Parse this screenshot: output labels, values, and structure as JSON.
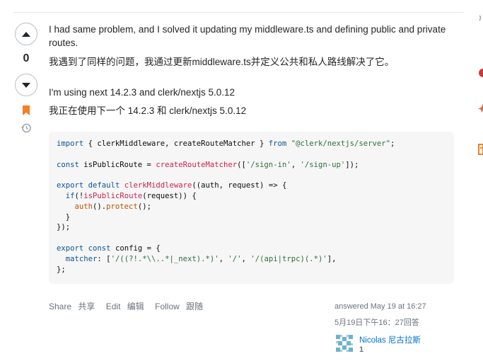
{
  "vote": {
    "count": "0"
  },
  "post": {
    "paragraph_en_1": "I had same problem, and I solved it updating my middleware.ts and defining public and private routes.",
    "paragraph_zh_1": "我遇到了同样的问题，我通过更新middleware.ts并定义公共和私人路线解决了它。",
    "paragraph_en_2": "I'm using next 14.2.3 and clerk/nextjs 5.0.12",
    "paragraph_zh_2": "我正在使用下一个 14.2.3 和 clerk/nextjs 5.0.12"
  },
  "code": {
    "l1a": "import",
    "l1b": " { clerkMiddleware, createRouteMatcher } ",
    "l1c": "from",
    "l1d": " ",
    "l1e": "\"@clerk/nextjs/server\"",
    "l1f": ";",
    "l3a": "const",
    "l3b": " isPublicRoute = ",
    "l3c": "createRouteMatcher",
    "l3d": "([",
    "l3e": "'/sign-in'",
    "l3f": ", ",
    "l3g": "'/sign-up'",
    "l3h": "]);",
    "l5a": "export",
    "l5b": " ",
    "l5c": "default",
    "l5d": " ",
    "l5e": "clerkMiddleware",
    "l5f": "((auth, request) => {",
    "l6a": "  ",
    "l6b": "if",
    "l6c": "(!",
    "l6d": "isPublicRoute",
    "l6e": "(request)) {",
    "l7a": "    ",
    "l7b": "auth",
    "l7c": "().",
    "l7d": "protect",
    "l7e": "();",
    "l8": "  }",
    "l9": "});",
    "l11a": "export",
    "l11b": " ",
    "l11c": "const",
    "l11d": " config = {",
    "l12a": "  ",
    "l12b": "matcher",
    "l12c": ": [",
    "l12d": "'/((?!.*\\\\..*|_next).*)'",
    "l12e": ", ",
    "l12f": "'/'",
    "l12g": ", ",
    "l12h": "'/(api|trpc)(.*)'",
    "l12i": "],",
    "l13": "};"
  },
  "actions": {
    "share": "Share",
    "share_zh": "共享",
    "edit": "Edit",
    "edit_zh": "编辑",
    "follow": "Follow",
    "follow_zh": "跟随"
  },
  "signature": {
    "answered": "answered May 19 at 16:27",
    "answered_zh": "5月19日下午16：27回答",
    "user_name": "Nicolas 尼古拉斯",
    "reputation": "1"
  },
  "colors": {
    "accent": "#0074cc",
    "bookmark": "#f48024",
    "code_bg": "#f6f6f6"
  }
}
